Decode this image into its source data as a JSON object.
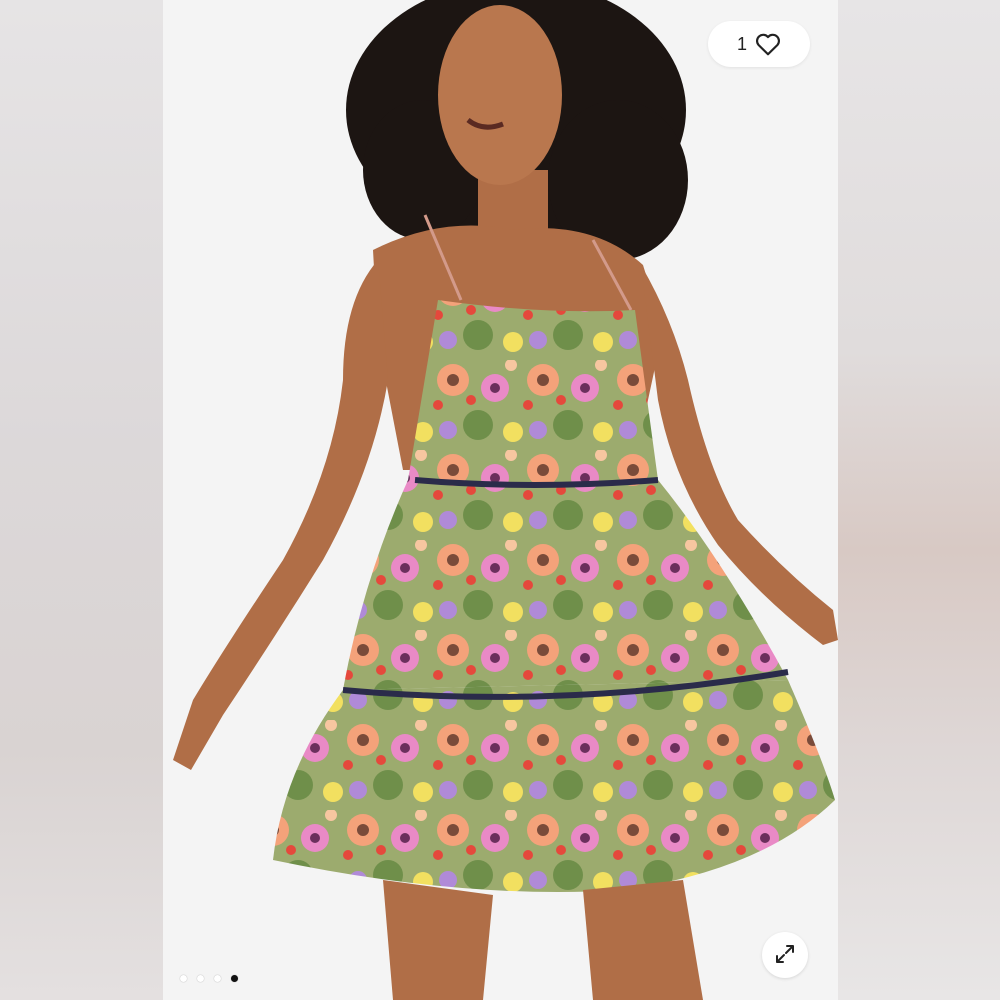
{
  "listing": {
    "like_count": "1",
    "like_icon": "heart-icon",
    "expand_icon": "expand-icon",
    "photo_subject": "floral-tiered-mini-dress"
  },
  "carousel": {
    "total_images": 4,
    "active_index": 3
  },
  "colors": {
    "background": "#f4f4f4",
    "pill": "#ffffff",
    "active_dot": "#111111",
    "inactive_dot": "#ffffff"
  }
}
